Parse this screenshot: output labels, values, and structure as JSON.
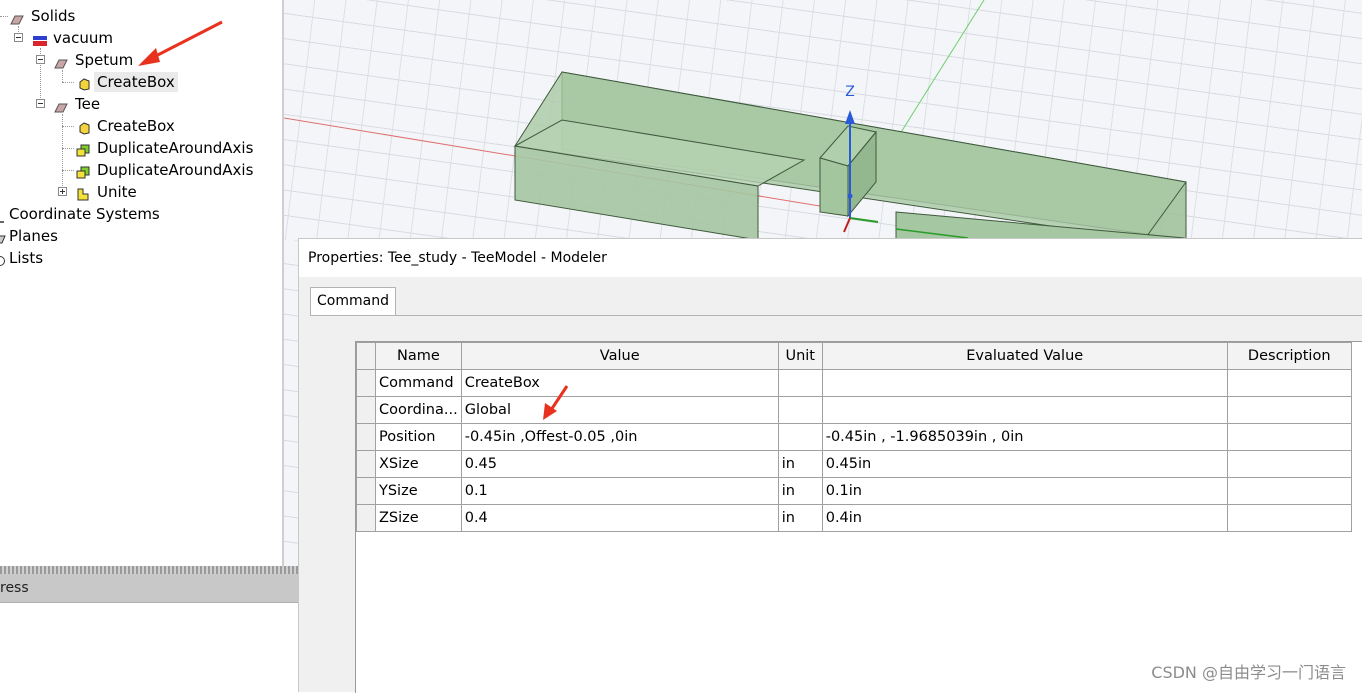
{
  "tree": {
    "solids": "Solids",
    "vacuum": "vacuum",
    "spetum": "Spetum",
    "spetum_createbox": "CreateBox",
    "tee": "Tee",
    "tee_createbox": "CreateBox",
    "duplicate1": "DuplicateAroundAxis",
    "duplicate2": "DuplicateAroundAxis",
    "unite": "Unite",
    "coordinate_systems": "Coordinate Systems",
    "planes": "Planes",
    "lists": "Lists"
  },
  "viewport": {
    "axis_z_label": "Z"
  },
  "progress_panel": {
    "title": "ress"
  },
  "properties": {
    "title": "Properties: Tee_study - TeeModel - Modeler",
    "tab": "Command",
    "columns": [
      "Name",
      "Value",
      "Unit",
      "Evaluated Value",
      "Description"
    ],
    "rows": [
      {
        "name": "Command",
        "value": "CreateBox",
        "unit": "",
        "evaluated": "",
        "description": ""
      },
      {
        "name": "Coordina...",
        "value": "Global",
        "unit": "",
        "evaluated": "",
        "description": ""
      },
      {
        "name": "Position",
        "value": "-0.45in ,Offest-0.05 ,0in",
        "unit": "",
        "evaluated": "-0.45in , -1.9685039in , 0in",
        "description": ""
      },
      {
        "name": "XSize",
        "value": "0.45",
        "unit": "in",
        "evaluated": "0.45in",
        "description": ""
      },
      {
        "name": "YSize",
        "value": "0.1",
        "unit": "in",
        "evaluated": "0.1in",
        "description": ""
      },
      {
        "name": "ZSize",
        "value": "0.4",
        "unit": "in",
        "evaluated": "0.4in",
        "description": ""
      }
    ]
  },
  "watermark": "CSDN @自由学习一门语言",
  "colors": {
    "annotation_arrow": "#e8321e",
    "box_fill": "#9cbf98",
    "box_edge": "#3f5a3c"
  }
}
